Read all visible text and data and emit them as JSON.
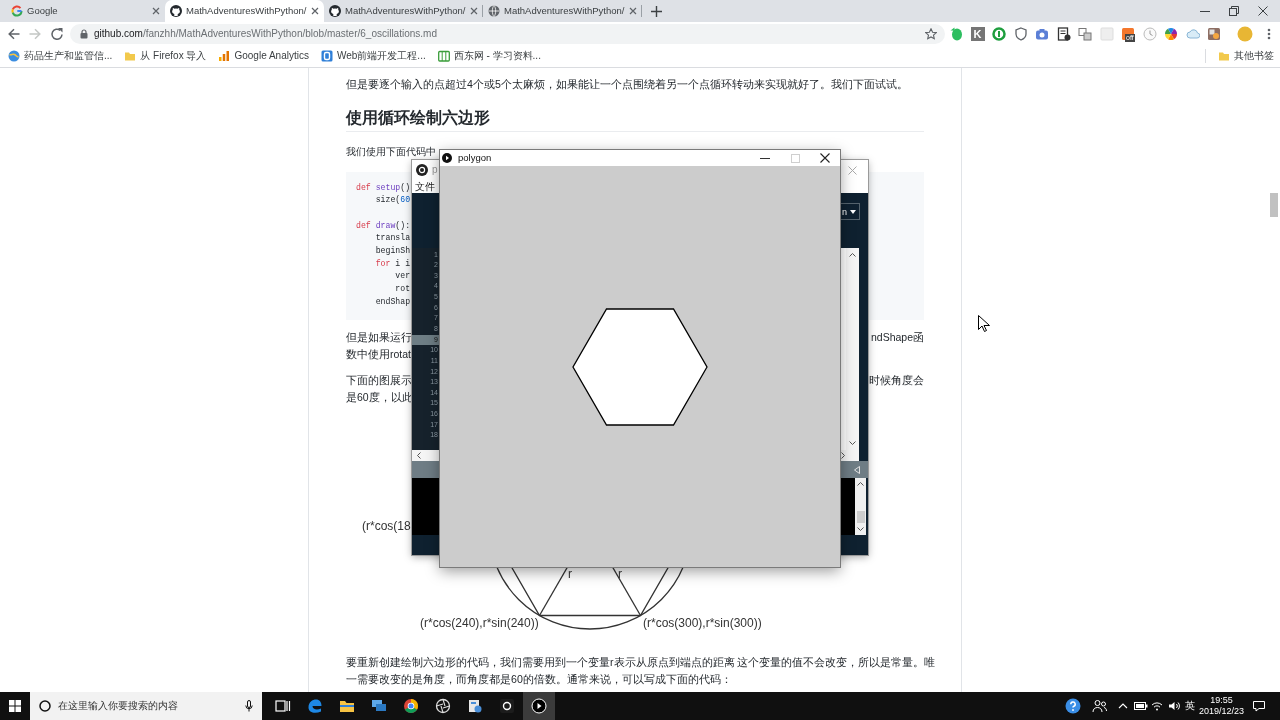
{
  "browser": {
    "tabs": [
      {
        "title": "Google",
        "kind": "google",
        "selected": false
      },
      {
        "title": "MathAdventuresWithPython/",
        "kind": "github",
        "selected": true
      },
      {
        "title": "MathAdventuresWithPython/",
        "kind": "github",
        "selected": false
      },
      {
        "title": "MathAdventuresWithPython/",
        "kind": "globe",
        "selected": false
      }
    ],
    "forward_disabled": true,
    "address": {
      "host": "github.com",
      "path": "/fanzhh/MathAdventuresWithPython/blob/master/6_oscillations.md"
    },
    "extensions": [
      {
        "kind": "note"
      },
      {
        "kind": "letter",
        "label": "K"
      },
      {
        "kind": "ring"
      },
      {
        "kind": "shield"
      },
      {
        "kind": "camera"
      },
      {
        "kind": "document"
      },
      {
        "kind": "squares"
      },
      {
        "kind": "blank"
      },
      {
        "kind": "badged",
        "label": "off"
      },
      {
        "kind": "clock"
      },
      {
        "kind": "wheel"
      },
      {
        "kind": "cloud"
      },
      {
        "kind": "picture"
      }
    ],
    "bookmarks": [
      {
        "label": "药品生产和监管信...",
        "kind": "globe"
      },
      {
        "label": "从 Firefox 导入",
        "kind": "folder"
      },
      {
        "label": "Google Analytics",
        "kind": "chart"
      },
      {
        "label": "Web前端开发工程...",
        "kind": "tile"
      },
      {
        "label": "西东网 - 学习资料...",
        "kind": "site"
      }
    ],
    "other_bookmarks": "其他书签"
  },
  "article": {
    "intro": "但是要逐个输入的点超过4个或5个太麻烦，如果能让一个点围绕着另一个点循环转动来实现就好了。我们下面试试。",
    "heading": "使用循环绘制六边形",
    "lead": "我们使用下面代码中",
    "code_groups": [
      {
        "lines": [
          {
            "tokens": [
              {
                "text": "def",
                "kind": "keyword"
              },
              {
                "text": " setup",
                "kind": "function"
              },
              {
                "text": "()",
                "kind": "plain"
              }
            ]
          },
          {
            "tokens": [
              {
                "text": "    size(",
                "kind": "plain"
              },
              {
                "text": "60",
                "kind": "number"
              }
            ]
          }
        ]
      },
      {
        "lines": [
          {
            "tokens": [
              {
                "text": "def",
                "kind": "keyword"
              },
              {
                "text": " draw",
                "kind": "function"
              },
              {
                "text": "():",
                "kind": "plain"
              }
            ]
          },
          {
            "tokens": [
              {
                "text": "    transla",
                "kind": "plain"
              }
            ]
          },
          {
            "tokens": [
              {
                "text": "    beginSh",
                "kind": "plain"
              }
            ]
          },
          {
            "tokens": [
              {
                "text": "    for",
                "kind": "keyword"
              },
              {
                "text": " i i",
                "kind": "plain"
              }
            ]
          },
          {
            "tokens": [
              {
                "text": "        ver",
                "kind": "plain"
              }
            ]
          },
          {
            "tokens": [
              {
                "text": "        rot",
                "kind": "plain"
              }
            ]
          },
          {
            "tokens": [
              {
                "text": "    endShap",
                "kind": "plain"
              }
            ]
          }
        ]
      }
    ],
    "covered_paragraphs": [
      {
        "lines": [
          {
            "left": "但是如果运行",
            "right": "ndShape函"
          },
          {
            "left": "数中使用rotat"
          }
        ]
      },
      {
        "lines": [
          {
            "left": "下面的图展示",
            "right": "时候角度会"
          },
          {
            "left": "是60度，以此"
          }
        ]
      }
    ],
    "figure": {
      "cut_label": "(r*cos(18",
      "radius_labels": [
        "r",
        "r"
      ],
      "vertex_labels": [
        "(r*cos(240),r*sin(240))",
        "(r*cos(300),r*sin(300))"
      ]
    },
    "closing_lines": [
      "要重新创建绘制六边形的代码，我们需要用到一个变量r表示从原点到端点的距离 这个变量的值不会改变，所以是常量。唯",
      "一需要改变的是角度，而角度都是60的倍数。通常来说，可以写成下面的代码："
    ]
  },
  "ide_window": {
    "title": "p",
    "menu": [
      "文件"
    ],
    "mode": "n",
    "line_numbers": [
      {
        "label": "1",
        "highlighted": false
      },
      {
        "label": "2",
        "highlighted": false
      },
      {
        "label": "3",
        "highlighted": false
      },
      {
        "label": "4",
        "highlighted": false
      },
      {
        "label": "5",
        "highlighted": false
      },
      {
        "label": "6",
        "highlighted": false
      },
      {
        "label": "7",
        "highlighted": false
      },
      {
        "label": "8",
        "highlighted": false
      },
      {
        "label": "9",
        "highlighted": true
      },
      {
        "label": "10",
        "highlighted": false
      },
      {
        "label": "11",
        "highlighted": false
      },
      {
        "label": "12",
        "highlighted": false
      },
      {
        "label": "13",
        "highlighted": false
      },
      {
        "label": "14",
        "highlighted": false
      },
      {
        "label": "15",
        "highlighted": false
      },
      {
        "label": "16",
        "highlighted": false
      },
      {
        "label": "17",
        "highlighted": false
      },
      {
        "label": "18",
        "highlighted": false
      }
    ]
  },
  "sketch_window": {
    "title": "polygon",
    "maximize_disabled": true
  },
  "taskbar": {
    "search_placeholder": "在这里输入你要搜索的内容",
    "apps": [
      {
        "kind": "task-view",
        "active": false
      },
      {
        "kind": "edge",
        "active": false
      },
      {
        "kind": "folder",
        "active": false
      },
      {
        "kind": "remote",
        "active": false
      },
      {
        "kind": "chrome",
        "active": false
      },
      {
        "kind": "aperture",
        "active": false
      },
      {
        "kind": "installer",
        "active": false
      },
      {
        "kind": "processing",
        "active": false
      },
      {
        "kind": "sketch",
        "active": true
      }
    ],
    "input_method": "英",
    "time": "19:55",
    "date": "2019/12/23"
  }
}
